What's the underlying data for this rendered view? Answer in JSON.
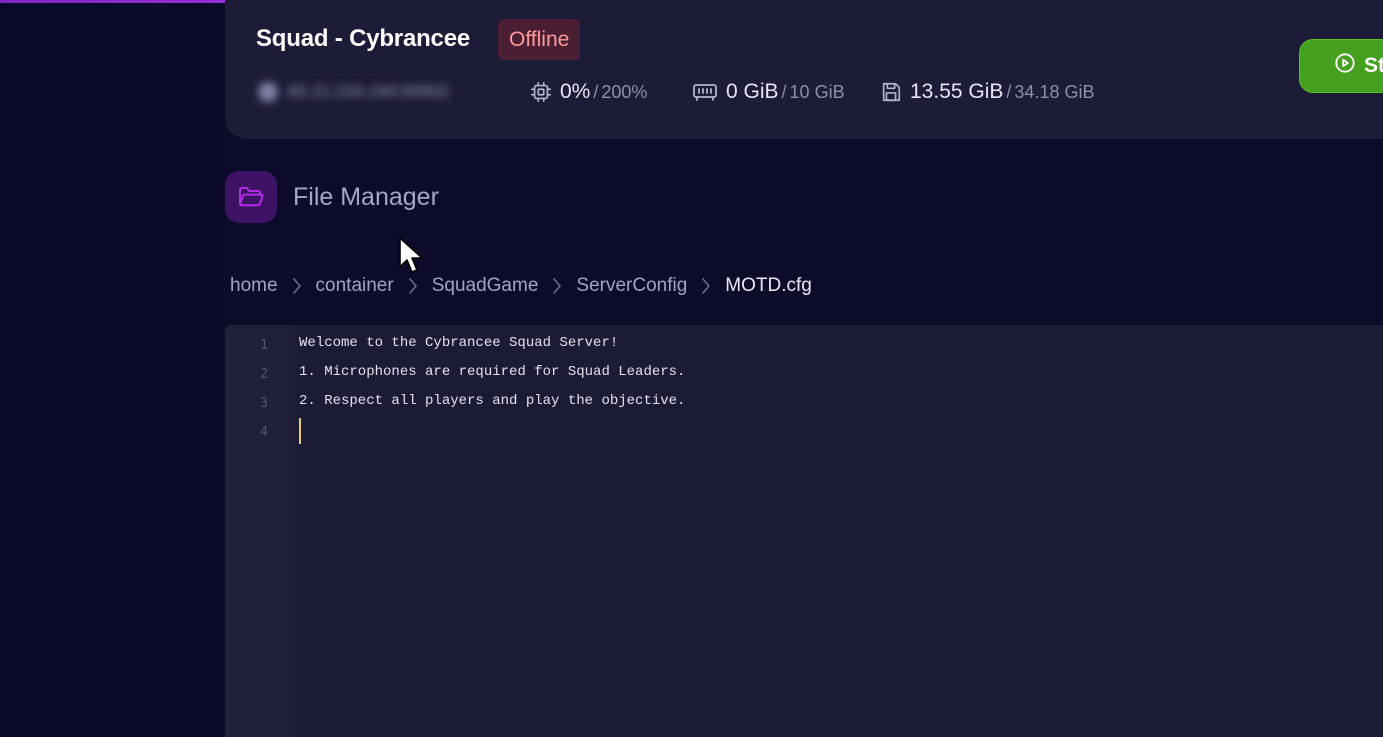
{
  "server": {
    "title": "Squad - Cybrancee",
    "status": "Offline",
    "ip_blurred": "65.21.216.240:50002",
    "cpu": {
      "value": "0%",
      "limit": "200%",
      "icon": "cpu-icon"
    },
    "memory": {
      "value": "0 GiB",
      "limit": "10 GiB",
      "icon": "memory-icon"
    },
    "disk": {
      "value": "13.55 GiB",
      "limit": "34.18 GiB",
      "icon": "save-disk-icon"
    },
    "start_button_label": "St",
    "colors": {
      "card": "#1c1b38",
      "status_bg": "#4a1f34",
      "status_text": "#ff9a9a",
      "start_green": "#46a020",
      "accent_purple": "#a23bd6"
    }
  },
  "file_manager": {
    "title": "File Manager",
    "icon": "folder-open-icon"
  },
  "breadcrumb": {
    "items": [
      "home",
      "container",
      "SquadGame",
      "ServerConfig",
      "MOTD.cfg"
    ],
    "separator_icon": "chevron-right-icon"
  },
  "editor": {
    "line_numbers": [
      "1",
      "2",
      "3",
      "4"
    ],
    "lines": [
      "Welcome to the Cybrancee Squad Server!",
      "1. Microphones are required for Squad Leaders.",
      "2. Respect all players and play the objective.",
      ""
    ]
  }
}
